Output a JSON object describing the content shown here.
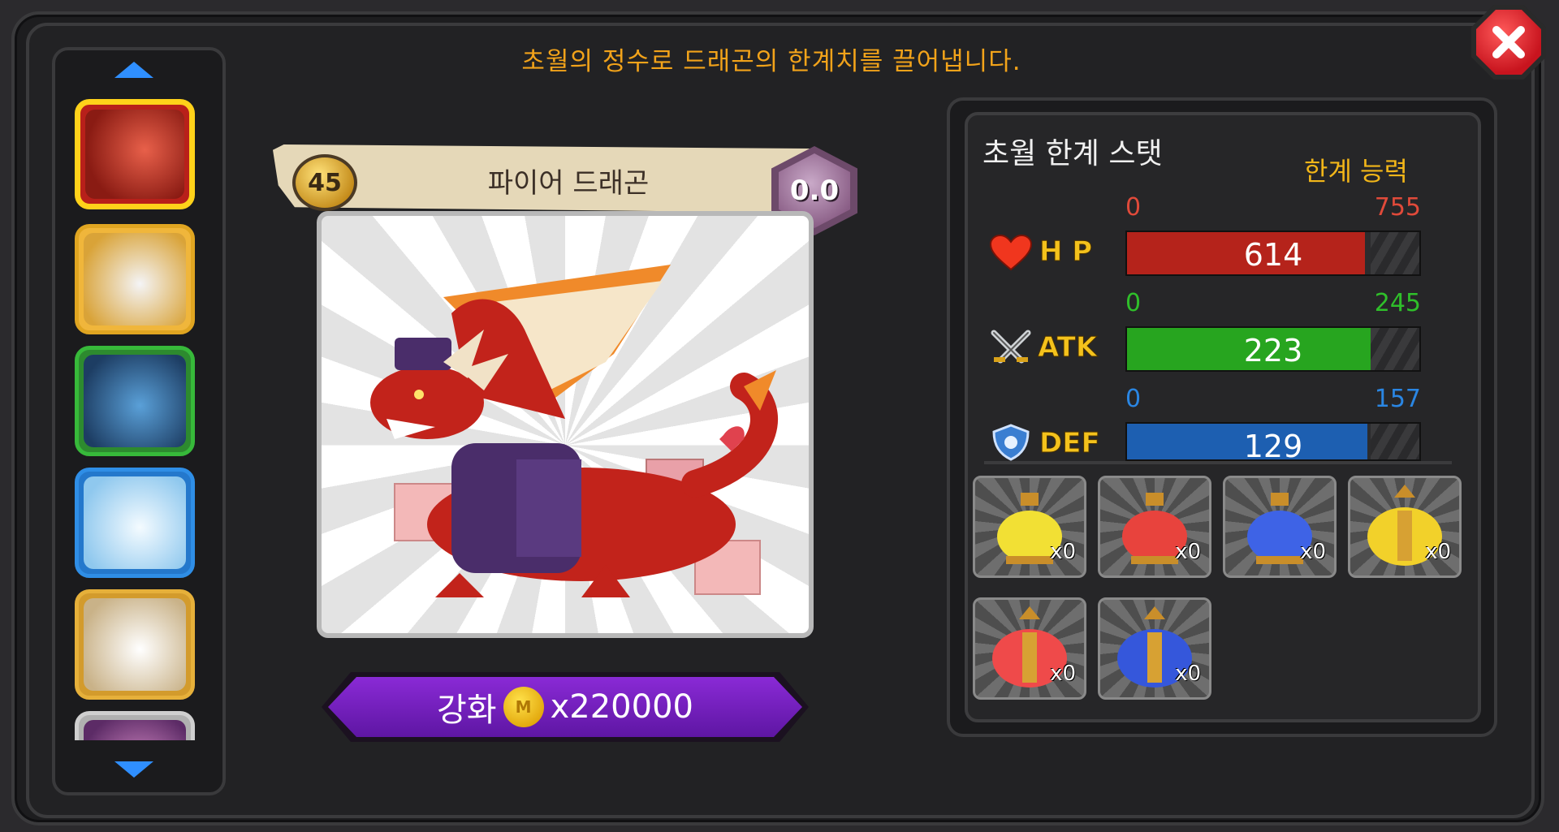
{
  "header": {
    "instruction": "초월의 정수로 드래곤의 한계치를 끌어냅니다."
  },
  "dragon": {
    "level": "45",
    "name": "파이어 드래곤",
    "rating": "0.0"
  },
  "enhance": {
    "label": "강화",
    "cost": "x220000",
    "coin_symbol": "M"
  },
  "stats": {
    "title": "초월 한계 스탯",
    "subtitle": "한계 능력",
    "rows": [
      {
        "label": "H P",
        "min": "0",
        "max": "755",
        "value": "614",
        "fraction": 0.813,
        "color": "#b5231b",
        "max_color": "#e04a3a"
      },
      {
        "label": "ATK",
        "min": "0",
        "max": "245",
        "value": "223",
        "fraction": 0.91,
        "color": "#27a51f",
        "max_color": "#2fbf2a"
      },
      {
        "label": "DEF",
        "min": "0",
        "max": "157",
        "value": "129",
        "fraction": 0.822,
        "color": "#1d5fb1",
        "max_color": "#2a86e3"
      }
    ]
  },
  "potions": [
    {
      "name": "yellow-potion-small",
      "count": "x0",
      "color": "#f2e034"
    },
    {
      "name": "red-potion-small",
      "count": "x0",
      "color": "#e8433d"
    },
    {
      "name": "blue-potion-small",
      "count": "x0",
      "color": "#3e63e6"
    },
    {
      "name": "yellow-potion-large",
      "count": "x0",
      "color": "#f2d12a"
    },
    {
      "name": "red-potion-large",
      "count": "x0",
      "color": "#ef4a4a"
    },
    {
      "name": "blue-potion-large",
      "count": "x0",
      "color": "#3557db"
    }
  ]
}
